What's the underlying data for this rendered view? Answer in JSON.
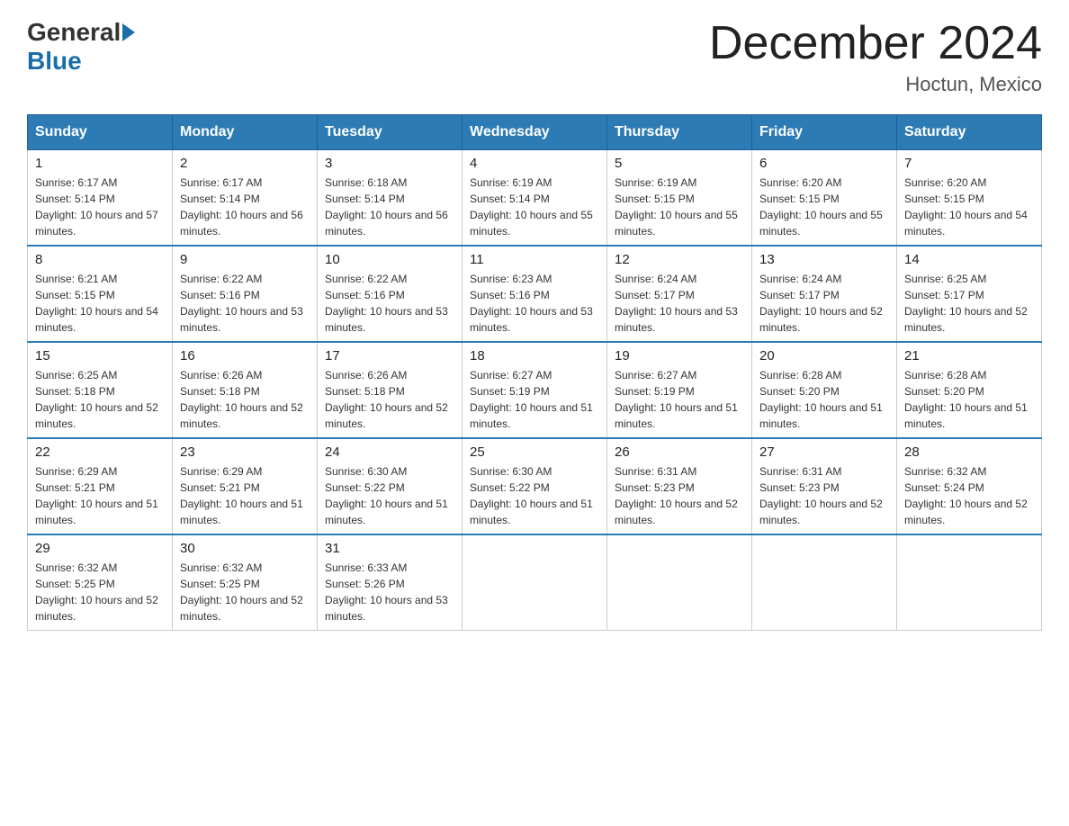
{
  "header": {
    "logo_general": "General",
    "logo_blue": "Blue",
    "month_title": "December 2024",
    "location": "Hoctun, Mexico"
  },
  "weekdays": [
    "Sunday",
    "Monday",
    "Tuesday",
    "Wednesday",
    "Thursday",
    "Friday",
    "Saturday"
  ],
  "weeks": [
    [
      {
        "day": "1",
        "sunrise": "6:17 AM",
        "sunset": "5:14 PM",
        "daylight": "10 hours and 57 minutes."
      },
      {
        "day": "2",
        "sunrise": "6:17 AM",
        "sunset": "5:14 PM",
        "daylight": "10 hours and 56 minutes."
      },
      {
        "day": "3",
        "sunrise": "6:18 AM",
        "sunset": "5:14 PM",
        "daylight": "10 hours and 56 minutes."
      },
      {
        "day": "4",
        "sunrise": "6:19 AM",
        "sunset": "5:14 PM",
        "daylight": "10 hours and 55 minutes."
      },
      {
        "day": "5",
        "sunrise": "6:19 AM",
        "sunset": "5:15 PM",
        "daylight": "10 hours and 55 minutes."
      },
      {
        "day": "6",
        "sunrise": "6:20 AM",
        "sunset": "5:15 PM",
        "daylight": "10 hours and 55 minutes."
      },
      {
        "day": "7",
        "sunrise": "6:20 AM",
        "sunset": "5:15 PM",
        "daylight": "10 hours and 54 minutes."
      }
    ],
    [
      {
        "day": "8",
        "sunrise": "6:21 AM",
        "sunset": "5:15 PM",
        "daylight": "10 hours and 54 minutes."
      },
      {
        "day": "9",
        "sunrise": "6:22 AM",
        "sunset": "5:16 PM",
        "daylight": "10 hours and 53 minutes."
      },
      {
        "day": "10",
        "sunrise": "6:22 AM",
        "sunset": "5:16 PM",
        "daylight": "10 hours and 53 minutes."
      },
      {
        "day": "11",
        "sunrise": "6:23 AM",
        "sunset": "5:16 PM",
        "daylight": "10 hours and 53 minutes."
      },
      {
        "day": "12",
        "sunrise": "6:24 AM",
        "sunset": "5:17 PM",
        "daylight": "10 hours and 53 minutes."
      },
      {
        "day": "13",
        "sunrise": "6:24 AM",
        "sunset": "5:17 PM",
        "daylight": "10 hours and 52 minutes."
      },
      {
        "day": "14",
        "sunrise": "6:25 AM",
        "sunset": "5:17 PM",
        "daylight": "10 hours and 52 minutes."
      }
    ],
    [
      {
        "day": "15",
        "sunrise": "6:25 AM",
        "sunset": "5:18 PM",
        "daylight": "10 hours and 52 minutes."
      },
      {
        "day": "16",
        "sunrise": "6:26 AM",
        "sunset": "5:18 PM",
        "daylight": "10 hours and 52 minutes."
      },
      {
        "day": "17",
        "sunrise": "6:26 AM",
        "sunset": "5:18 PM",
        "daylight": "10 hours and 52 minutes."
      },
      {
        "day": "18",
        "sunrise": "6:27 AM",
        "sunset": "5:19 PM",
        "daylight": "10 hours and 51 minutes."
      },
      {
        "day": "19",
        "sunrise": "6:27 AM",
        "sunset": "5:19 PM",
        "daylight": "10 hours and 51 minutes."
      },
      {
        "day": "20",
        "sunrise": "6:28 AM",
        "sunset": "5:20 PM",
        "daylight": "10 hours and 51 minutes."
      },
      {
        "day": "21",
        "sunrise": "6:28 AM",
        "sunset": "5:20 PM",
        "daylight": "10 hours and 51 minutes."
      }
    ],
    [
      {
        "day": "22",
        "sunrise": "6:29 AM",
        "sunset": "5:21 PM",
        "daylight": "10 hours and 51 minutes."
      },
      {
        "day": "23",
        "sunrise": "6:29 AM",
        "sunset": "5:21 PM",
        "daylight": "10 hours and 51 minutes."
      },
      {
        "day": "24",
        "sunrise": "6:30 AM",
        "sunset": "5:22 PM",
        "daylight": "10 hours and 51 minutes."
      },
      {
        "day": "25",
        "sunrise": "6:30 AM",
        "sunset": "5:22 PM",
        "daylight": "10 hours and 51 minutes."
      },
      {
        "day": "26",
        "sunrise": "6:31 AM",
        "sunset": "5:23 PM",
        "daylight": "10 hours and 52 minutes."
      },
      {
        "day": "27",
        "sunrise": "6:31 AM",
        "sunset": "5:23 PM",
        "daylight": "10 hours and 52 minutes."
      },
      {
        "day": "28",
        "sunrise": "6:32 AM",
        "sunset": "5:24 PM",
        "daylight": "10 hours and 52 minutes."
      }
    ],
    [
      {
        "day": "29",
        "sunrise": "6:32 AM",
        "sunset": "5:25 PM",
        "daylight": "10 hours and 52 minutes."
      },
      {
        "day": "30",
        "sunrise": "6:32 AM",
        "sunset": "5:25 PM",
        "daylight": "10 hours and 52 minutes."
      },
      {
        "day": "31",
        "sunrise": "6:33 AM",
        "sunset": "5:26 PM",
        "daylight": "10 hours and 53 minutes."
      },
      null,
      null,
      null,
      null
    ]
  ]
}
